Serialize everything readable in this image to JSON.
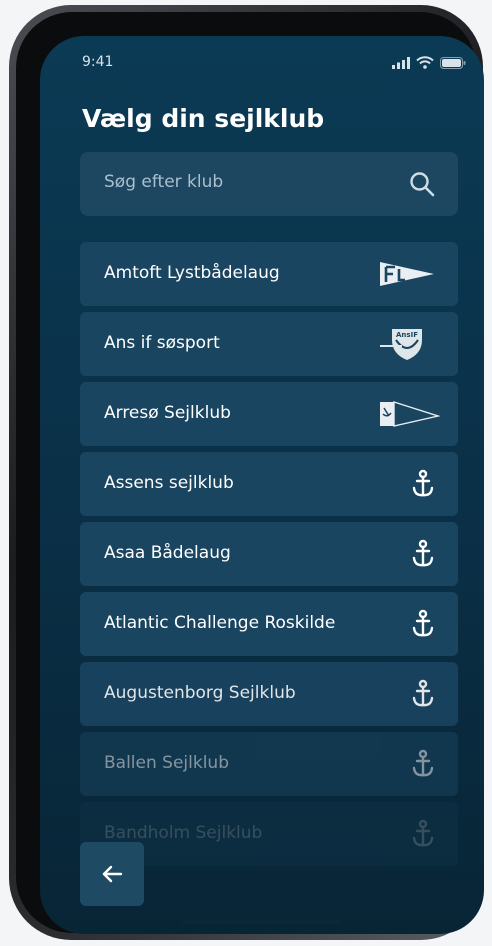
{
  "status_bar": {
    "time": "9:41"
  },
  "title": "Vælg din sejlklub",
  "search": {
    "placeholder": "Søg efter klub"
  },
  "clubs": [
    {
      "name": "Amtoft Lystbådelaug",
      "icon": "pennant-logo-icon"
    },
    {
      "name": "Ans if søsport",
      "icon": "shield-logo-icon"
    },
    {
      "name": "Arresø Sejlklub",
      "icon": "pennant-anchor-logo-icon"
    },
    {
      "name": "Assens sejlklub",
      "icon": "anchor-icon"
    },
    {
      "name": "Asaa Bådelaug",
      "icon": "anchor-icon"
    },
    {
      "name": "Atlantic Challenge Roskilde",
      "icon": "anchor-icon"
    },
    {
      "name": "Augustenborg Sejlklub",
      "icon": "anchor-icon"
    },
    {
      "name": "Ballen Sejlklub",
      "icon": "anchor-icon"
    },
    {
      "name": "Bandholm Sejlklub",
      "icon": "anchor-icon"
    }
  ],
  "colors": {
    "background": "#0a2f46",
    "card": "#1a4560",
    "text": "#ffffff"
  }
}
